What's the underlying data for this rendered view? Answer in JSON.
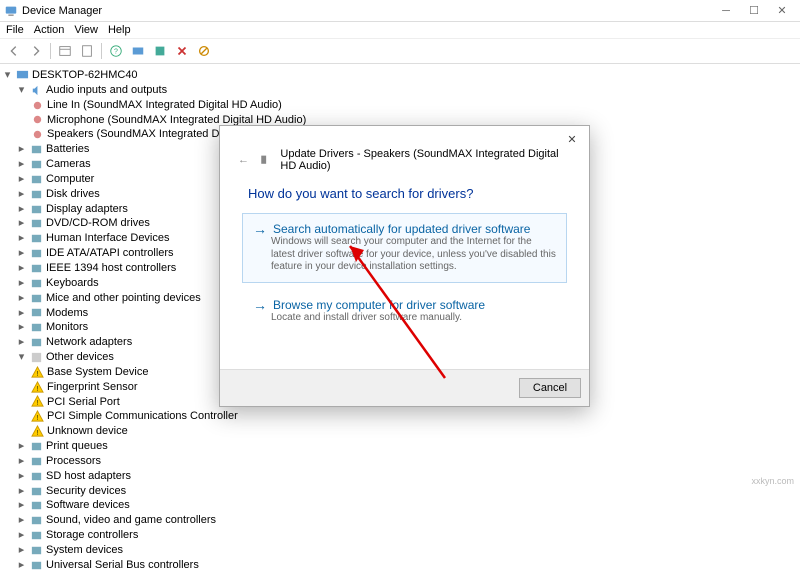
{
  "window": {
    "title": "Device Manager"
  },
  "menu": [
    "File",
    "Action",
    "View",
    "Help"
  ],
  "tree": {
    "root": "DESKTOP-62HMC40",
    "audio": {
      "label": "Audio inputs and outputs",
      "children": [
        "Line In (SoundMAX Integrated Digital HD Audio)",
        "Microphone (SoundMAX Integrated Digital HD Audio)",
        "Speakers (SoundMAX Integrated Digital HD Audio)"
      ]
    },
    "items": [
      "Batteries",
      "Cameras",
      "Computer",
      "Disk drives",
      "Display adapters",
      "DVD/CD-ROM drives",
      "Human Interface Devices",
      "IDE ATA/ATAPI controllers",
      "IEEE 1394 host controllers",
      "Keyboards",
      "Mice and other pointing devices",
      "Modems",
      "Monitors",
      "Network adapters"
    ],
    "other": {
      "label": "Other devices",
      "children": [
        "Base System Device",
        "Fingerprint Sensor",
        "PCI Serial Port",
        "PCI Simple Communications Controller",
        "Unknown device"
      ]
    },
    "items2": [
      "Print queues",
      "Processors",
      "SD host adapters",
      "Security devices",
      "Software devices",
      "Sound, video and game controllers",
      "Storage controllers",
      "System devices",
      "Universal Serial Bus controllers"
    ]
  },
  "dialog": {
    "title": "Update Drivers - Speakers (SoundMAX Integrated Digital HD Audio)",
    "question": "How do you want to search for drivers?",
    "opt1": {
      "title": "Search automatically for updated driver software",
      "desc": "Windows will search your computer and the Internet for the latest driver software for your device, unless you've disabled this feature in your device installation settings."
    },
    "opt2": {
      "title": "Browse my computer for driver software",
      "desc": "Locate and install driver software manually."
    },
    "cancel": "Cancel"
  },
  "watermark": "xxkyn.com"
}
